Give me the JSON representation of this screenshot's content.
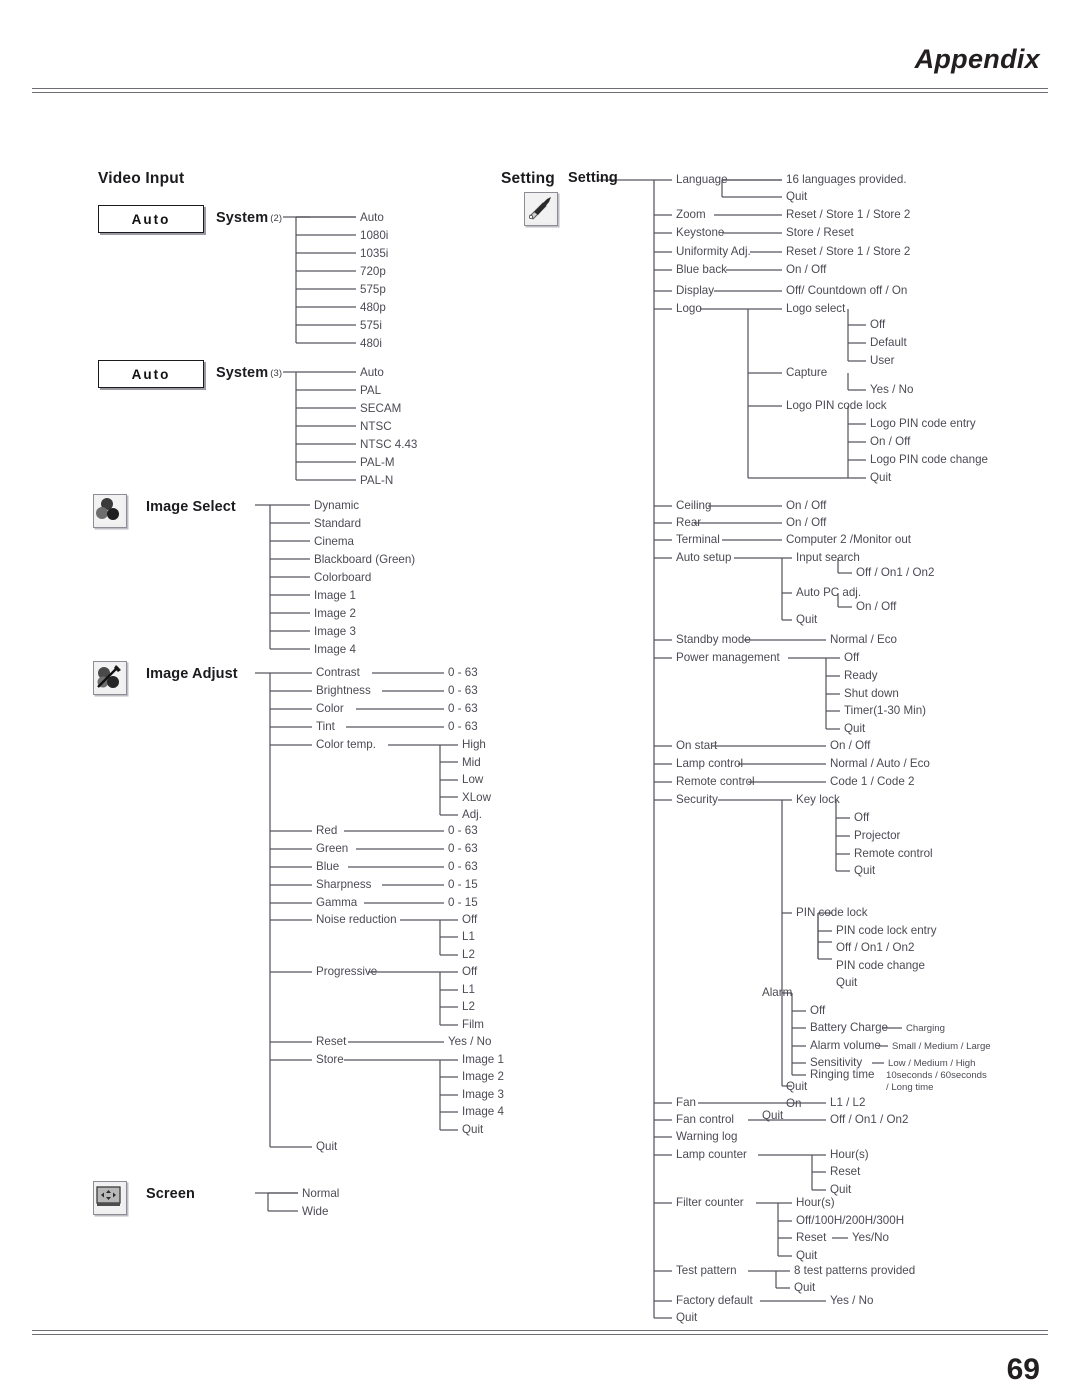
{
  "header": {
    "title": "Appendix",
    "page_number": "69"
  },
  "left": {
    "section_title": "Video Input",
    "system2": {
      "box_value": "Auto",
      "label": "System",
      "sup": "(2)",
      "options": [
        "Auto",
        "1080i",
        "1035i",
        "720p",
        "575p",
        "480p",
        "575i",
        "480i"
      ]
    },
    "system3": {
      "box_value": "Auto",
      "label": "System",
      "sup": "(3)",
      "options": [
        "Auto",
        "PAL",
        "SECAM",
        "NTSC",
        "NTSC 4.43",
        "PAL-M",
        "PAL-N"
      ]
    },
    "image_select": {
      "label": "Image Select",
      "icon": "image-select-icon",
      "options": [
        "Dynamic",
        "Standard",
        "Cinema",
        "Blackboard (Green)",
        "Colorboard",
        "Image 1",
        "Image 2",
        "Image 3",
        "Image 4"
      ]
    },
    "image_adjust": {
      "label": "Image Adjust",
      "icon": "image-adjust-icon",
      "items": [
        {
          "name": "Contrast",
          "value": "0 - 63"
        },
        {
          "name": "Brightness",
          "value": "0 - 63"
        },
        {
          "name": "Color",
          "value": "0 - 63"
        },
        {
          "name": "Tint",
          "value": "0 - 63"
        },
        {
          "name": "Color temp.",
          "children": [
            "High",
            "Mid",
            "Low",
            "XLow",
            "Adj."
          ]
        },
        {
          "name": "Red",
          "value": "0 - 63"
        },
        {
          "name": "Green",
          "value": "0 - 63"
        },
        {
          "name": "Blue",
          "value": "0 - 63"
        },
        {
          "name": "Sharpness",
          "value": "0 - 15"
        },
        {
          "name": "Gamma",
          "value": "0 - 15"
        },
        {
          "name": "Noise reduction",
          "children": [
            "Off",
            "L1",
            "L2"
          ]
        },
        {
          "name": "Progressive",
          "children": [
            "Off",
            "L1",
            "L2",
            "Film"
          ]
        },
        {
          "name": "Reset",
          "value": "Yes / No"
        },
        {
          "name": "Store",
          "children": [
            "Image 1",
            "Image 2",
            "Image 3",
            "Image 4",
            "Quit"
          ]
        },
        {
          "name": "Quit"
        }
      ]
    },
    "screen": {
      "label": "Screen",
      "icon": "screen-icon",
      "options": [
        "Normal",
        "Wide"
      ]
    }
  },
  "right": {
    "section_title": "Setting",
    "icon": "setting-icon",
    "root_label": "Setting",
    "items": [
      {
        "name": "Language",
        "children": [
          "16 languages provided.",
          "Quit"
        ]
      },
      {
        "name": "Zoom",
        "value": "Reset / Store 1 / Store 2"
      },
      {
        "name": "Keystone",
        "value": "Store / Reset"
      },
      {
        "name": "Uniformity Adj.",
        "value": "Reset / Store 1 / Store 2"
      },
      {
        "name": "Blue back",
        "value": "On / Off"
      },
      {
        "name": "Display",
        "value": "Off/ Countdown off / On"
      },
      {
        "name": "Logo",
        "children": [
          {
            "name": "Logo select",
            "children": [
              "Off",
              "Default",
              "User"
            ]
          },
          {
            "name": "Capture",
            "children": [
              "Yes / No"
            ]
          },
          {
            "name": "Logo PIN code lock",
            "children": [
              "Logo PIN code entry",
              "On / Off",
              "Logo PIN code change",
              "Quit"
            ]
          },
          {
            "name": "Quit"
          }
        ]
      },
      {
        "name": "Ceiling",
        "value": "On / Off"
      },
      {
        "name": "Rear",
        "value": "On / Off"
      },
      {
        "name": "Terminal",
        "value": "Computer 2 /Monitor out"
      },
      {
        "name": "Auto setup",
        "children": [
          {
            "name": "Input search",
            "children": [
              "Off / On1 / On2"
            ]
          },
          {
            "name": "Auto PC adj.",
            "children": [
              "On / Off"
            ]
          },
          {
            "name": "Quit"
          }
        ]
      },
      {
        "name": "Standby mode",
        "value": "Normal / Eco"
      },
      {
        "name": "Power management",
        "children": [
          "Off",
          "Ready",
          "Shut down",
          "Timer(1-30 Min)",
          "Quit"
        ]
      },
      {
        "name": "On start",
        "value": "On / Off"
      },
      {
        "name": "Lamp control",
        "value": "Normal / Auto / Eco"
      },
      {
        "name": "Remote control",
        "value": "Code 1 / Code 2"
      },
      {
        "name": "Security",
        "children": [
          {
            "name": "Key lock",
            "children": [
              "Off",
              "Projector",
              "Remote control",
              "Quit"
            ]
          },
          {
            "name": "PIN code lock",
            "children": [
              "PIN code lock entry",
              "Off / On1 / On2",
              "PIN code change",
              "Quit"
            ]
          },
          {
            "name": "Alarm",
            "children": [
              {
                "name": "Off"
              },
              {
                "name": "Battery Charge",
                "value": "Charging"
              },
              {
                "name": "Alarm volume",
                "value": "Small / Medium / Large"
              },
              {
                "name": "Sensitivity",
                "value": "Low / Medium / High"
              },
              {
                "name": "Ringing time",
                "value": "10seconds / 60seconds",
                "value2": "/ Long time"
              },
              {
                "name": "Quit"
              },
              {
                "name": "On"
              }
            ]
          },
          {
            "name": "Quit"
          }
        ]
      },
      {
        "name": "Fan",
        "value": "L1 / L2"
      },
      {
        "name": "Fan control",
        "value": "Off / On1 / On2"
      },
      {
        "name": "Warning log"
      },
      {
        "name": "Lamp counter",
        "children": [
          "Hour(s)",
          "Reset",
          "Quit"
        ]
      },
      {
        "name": "Filter counter",
        "children": [
          "Hour(s)",
          "Off/100H/200H/300H",
          "Reset",
          "Quit"
        ],
        "reset_value": "Yes/No"
      },
      {
        "name": "Test pattern",
        "children": [
          "8 test patterns provided",
          "Quit"
        ]
      },
      {
        "name": "Factory default",
        "value": "Yes / No"
      },
      {
        "name": "Quit"
      }
    ]
  }
}
